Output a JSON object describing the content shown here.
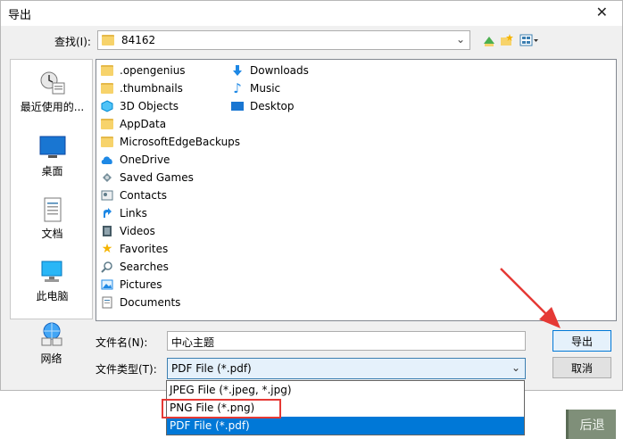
{
  "dialog": {
    "title": "导出",
    "close_glyph": "✕"
  },
  "lookin": {
    "label": "查找(I):",
    "value": "84162"
  },
  "places": [
    {
      "label": "最近使用的..."
    },
    {
      "label": "桌面"
    },
    {
      "label": "文档"
    },
    {
      "label": "此电脑"
    },
    {
      "label": "网络"
    }
  ],
  "files": {
    "col1": [
      ".opengenius",
      ".thumbnails",
      "3D Objects",
      "AppData",
      "MicrosoftEdgeBackups",
      "OneDrive",
      "Saved Games",
      "Contacts",
      "Links",
      "Videos",
      "Favorites",
      "Searches",
      "Pictures",
      "Documents"
    ],
    "col2": [
      "Downloads",
      "Music",
      "Desktop"
    ]
  },
  "filename": {
    "label": "文件名(N):",
    "value": "中心主题"
  },
  "filetype": {
    "label": "文件类型(T):",
    "value": "PDF File (*.pdf)",
    "options": [
      "JPEG File (*.jpeg, *.jpg)",
      "PNG File (*.png)",
      "PDF File (*.pdf)"
    ]
  },
  "buttons": {
    "export": "导出",
    "cancel": "取消"
  },
  "outside": {
    "back": "后退"
  },
  "colors": {
    "accent": "#0078d7",
    "annotation": "#e53935"
  }
}
